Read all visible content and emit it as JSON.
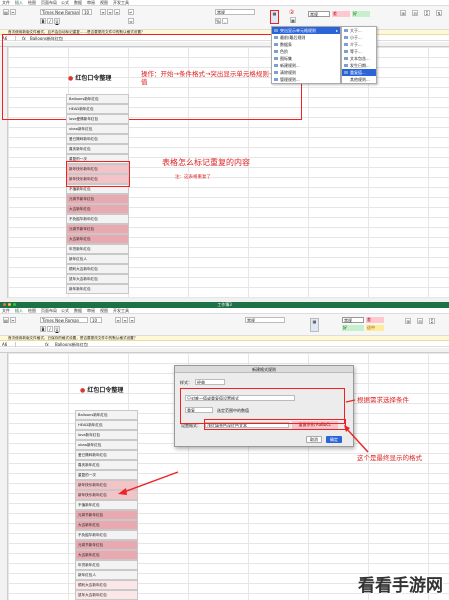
{
  "panel1": {
    "tabs": [
      "文件",
      "插入",
      "绘图",
      "页面布局",
      "公式",
      "数据",
      "审阅",
      "视图",
      "开发工具"
    ],
    "ribbon": {
      "font": "Times New Roman",
      "size": "10",
      "format": "常规",
      "style_labels": [
        "常规",
        "差",
        "好"
      ]
    },
    "callout_num": "②",
    "notice": "首次使用新版文件格式，且不会自动标记重复……是否要更改文件中的默认格式设置？",
    "namebox": "A6",
    "formula": "Balloons新年红包",
    "sheet_title": "红包口令整理",
    "cells": [
      "Balloons新年红包",
      "HEAD新年红包",
      "love爱情新年红包",
      "ubaa新年红包",
      "爱已撕碎新年红包",
      "喜庆新年红包",
      "重复的一次",
      "新年快乐新年红包",
      "新年快乐新年红包",
      "不值新年红包",
      "元宵节新年红包",
      "大吉新年红包",
      "不负韶华新年红包",
      "元宵节新年红包",
      "大吉新年红包",
      "年货新年红包",
      "新年红包人",
      "顺利大吉新年红包",
      "鼠年大吉新年红包",
      "新年新年红包"
    ],
    "instruction": "操作：开始→条件格式→突出显示单元格规则→重复值",
    "big_note": "表格怎么标记重复的内容",
    "sub_note": "注：这表格重复了",
    "menu": {
      "items": [
        "突出显示单元格规则",
        "最前/最后规则",
        "数据条",
        "色阶",
        "图标集",
        "新建规则...",
        "清除规则",
        "管理规则..."
      ],
      "submenu": [
        "大于...",
        "小于...",
        "介于...",
        "等于...",
        "文本包含...",
        "发生日期...",
        "重复值...",
        "其他规则..."
      ]
    }
  },
  "panel2": {
    "window_title": "工作簿3",
    "tabs": [
      "文件",
      "插入",
      "绘图",
      "页面布局",
      "公式",
      "数据",
      "审阅",
      "视图",
      "开发工具"
    ],
    "ribbon": {
      "font": "Times New Roman",
      "size": "10",
      "format": "常规",
      "style_labels": [
        "常规",
        "差",
        "好",
        "适中"
      ]
    },
    "notice": "首次使用新版文件格式，已保存的格式设置，是否要更改文件中的默认格式设置？",
    "namebox": "A6",
    "formula": "Balloons新年红包",
    "sheet_title": "红包口令整理",
    "cells": [
      "Balloons新年红包",
      "HEAD新年红包",
      "love新年红包",
      "ubaa新年红包",
      "爱已撕碎新年红包",
      "喜庆新年红包",
      "重复的一次",
      "新年快乐新年红包",
      "新年快乐新年红包",
      "不值新年红包",
      "元宵节新年红包",
      "大吉新年红包",
      "不负韶华新年红包",
      "元宵节新年红包",
      "大吉新年红包",
      "年货新年红包",
      "新年红包人",
      "顺利大吉新年红包",
      "鼠年大吉新年红包"
    ],
    "dialog": {
      "title": "新建格式规则",
      "style_label": "样式：",
      "style_value": "经典",
      "rule_value": "只对唯一值或重复值设置格式",
      "dup_value": "重复",
      "dup_suffix": "选定范围中的数值",
      "format_label": "设置格式：",
      "format_value": "浅红填充色深红色文本",
      "preview": "重复示例 AaBbCc",
      "cancel": "取消",
      "ok": "确定"
    },
    "note1": "根据需求选择条件",
    "note2": "这个是最终显示的格式"
  },
  "watermark": "看看手游网",
  "colors": {
    "excel_green": "#1e7145",
    "dup_fill": "#f2c4c8",
    "dup_fill_strong": "#e8aab0",
    "annot_red": "#e02020",
    "select_blue": "#2b63d9"
  }
}
